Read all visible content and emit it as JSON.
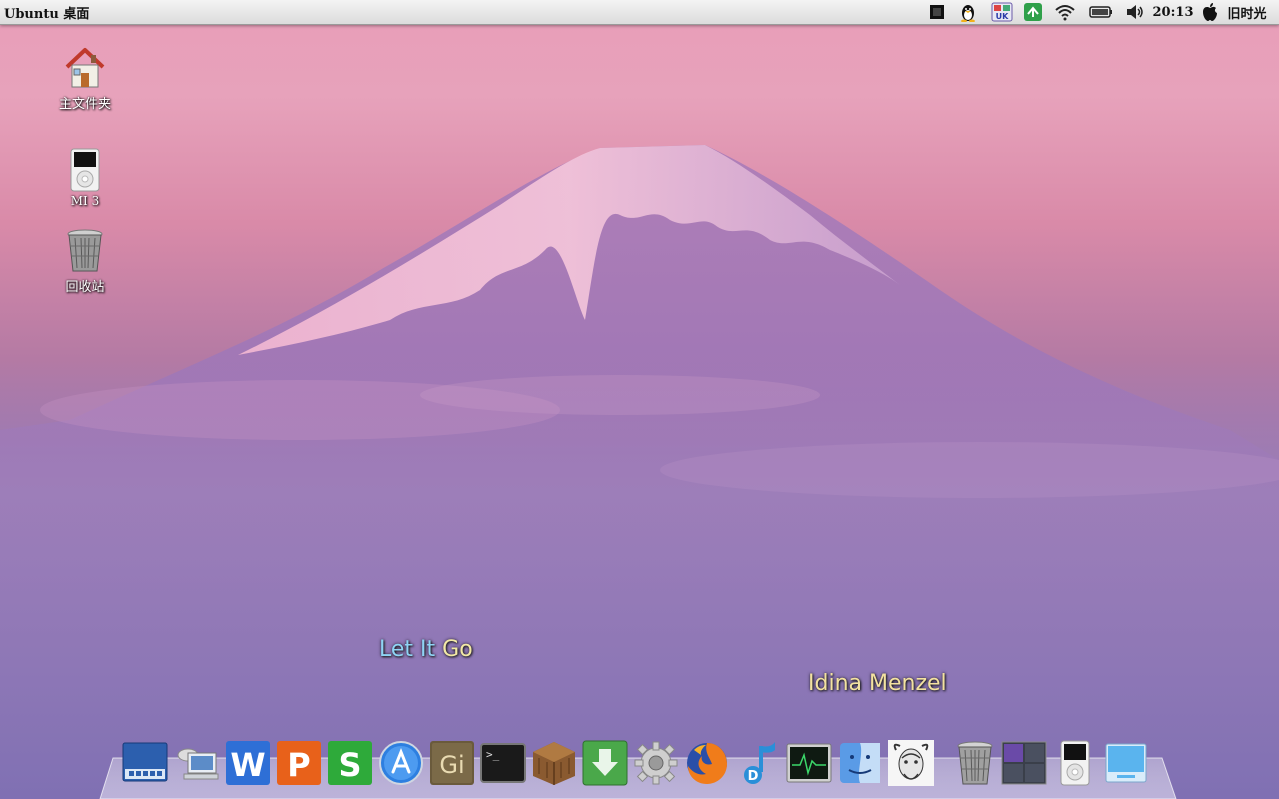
{
  "panel": {
    "title": "Ubuntu 桌面",
    "clock": "20:13",
    "user": "旧时光",
    "tray_icons": [
      "app-indicator-icon",
      "penguin-qq-icon",
      "input-method-uk-icon",
      "network-sync-icon",
      "wifi-icon",
      "battery-icon",
      "volume-icon",
      "apple-logo-icon"
    ]
  },
  "desktop": {
    "icons": [
      {
        "name": "home-folder",
        "label": "主文件夹",
        "icon": "house-icon"
      },
      {
        "name": "mi3-device",
        "label": "MI 3",
        "icon": "ipod-icon"
      },
      {
        "name": "trash",
        "label": "回收站",
        "icon": "trash-can-icon"
      }
    ]
  },
  "lyrics": {
    "line1_part1": "Let It",
    "line1_part2": "Go",
    "line2": "Idina Menzel"
  },
  "dock": {
    "items": [
      {
        "name": "launchpad",
        "icon": "launchpad-grid-icon"
      },
      {
        "name": "network",
        "icon": "network-computer-icon"
      },
      {
        "name": "wps-writer",
        "icon": "wps-w-icon",
        "letter": "W"
      },
      {
        "name": "wps-presentation",
        "icon": "wps-p-icon",
        "letter": "P"
      },
      {
        "name": "wps-spreadsheet",
        "icon": "wps-s-icon",
        "letter": "S"
      },
      {
        "name": "app-store",
        "icon": "app-store-icon"
      },
      {
        "name": "gimp",
        "icon": "gimp-icon",
        "letter": "Gi"
      },
      {
        "name": "terminal",
        "icon": "terminal-icon",
        "prompt": ">_"
      },
      {
        "name": "minecraft",
        "icon": "crafting-table-icon"
      },
      {
        "name": "download-manager",
        "icon": "download-icon"
      },
      {
        "name": "system-settings",
        "icon": "gear-icon"
      },
      {
        "name": "firefox",
        "icon": "firefox-icon"
      },
      {
        "name": "music-player",
        "icon": "music-note-icon"
      },
      {
        "name": "system-monitor",
        "icon": "activity-monitor-icon"
      },
      {
        "name": "finder",
        "icon": "finder-icon"
      },
      {
        "name": "gnu-app",
        "icon": "gnu-head-icon"
      },
      {
        "name": "dock-trash",
        "icon": "trash-can-icon"
      },
      {
        "name": "workspace-switcher",
        "icon": "workspaces-icon"
      },
      {
        "name": "ipod-device",
        "icon": "ipod-icon"
      },
      {
        "name": "show-desktop",
        "icon": "desktop-window-icon"
      }
    ]
  }
}
